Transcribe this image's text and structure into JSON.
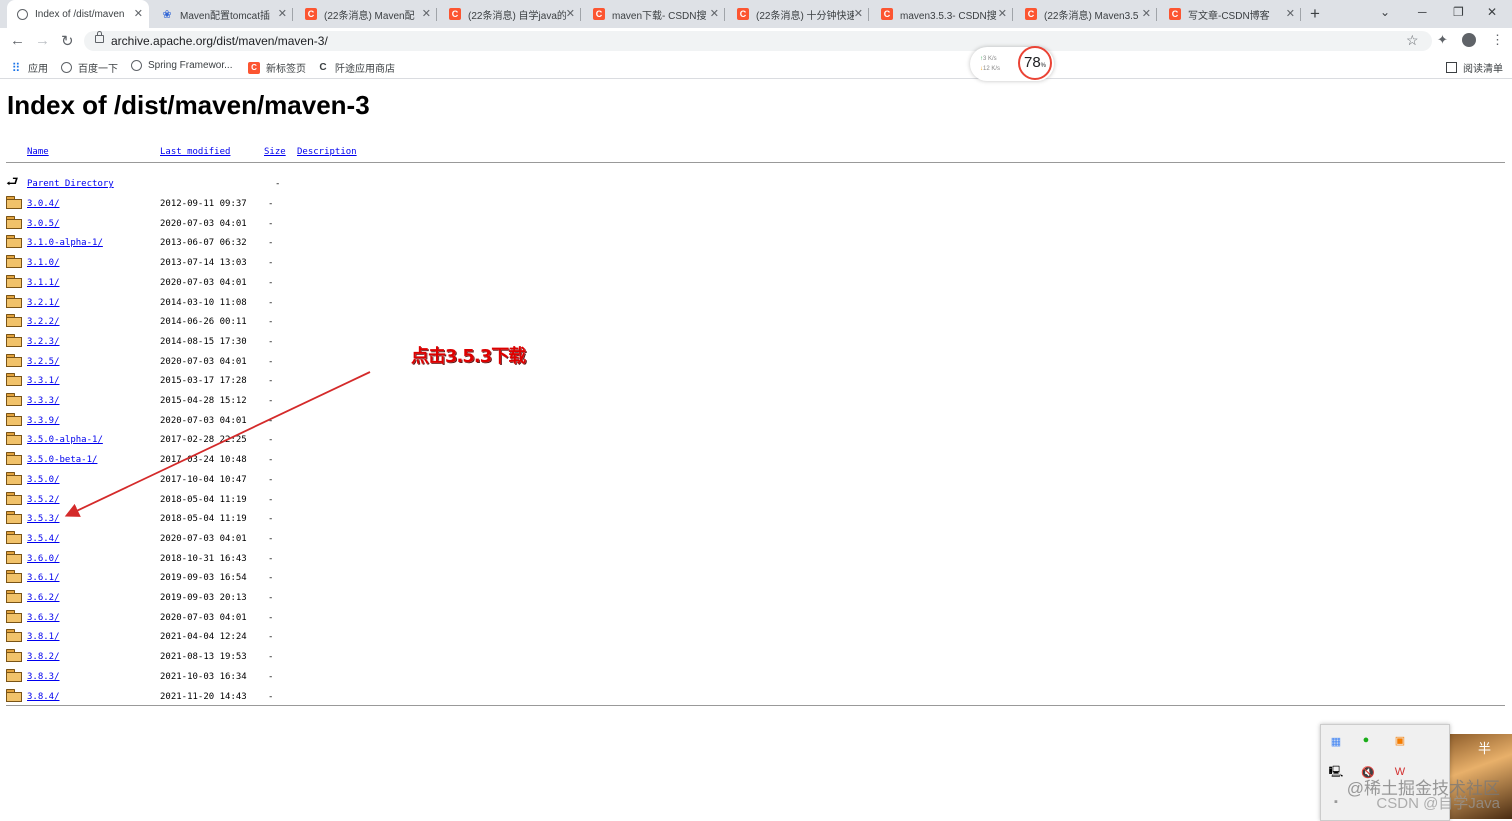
{
  "browser": {
    "tabs": [
      {
        "title": "Index of /dist/maven",
        "icon": "globe-icon",
        "active": true
      },
      {
        "title": "Maven配置tomcat插",
        "icon": "paw-icon"
      },
      {
        "title": "(22条消息) Maven配",
        "icon": "csdn-icon"
      },
      {
        "title": "(22条消息) 自学java的",
        "icon": "csdn-icon"
      },
      {
        "title": "maven下载- CSDN搜",
        "icon": "csdn-icon"
      },
      {
        "title": "(22条消息) 十分钟快速",
        "icon": "csdn-icon"
      },
      {
        "title": "maven3.5.3- CSDN搜",
        "icon": "csdn-icon"
      },
      {
        "title": "(22条消息) Maven3.5",
        "icon": "csdn-icon"
      },
      {
        "title": "写文章-CSDN博客",
        "icon": "csdn-icon"
      }
    ],
    "url": "archive.apache.org/dist/maven/maven-3/",
    "bookmarks": [
      {
        "label": "应用",
        "icon": "apps-grid-icon"
      },
      {
        "label": "百度一下",
        "icon": "globe-icon"
      },
      {
        "label": "Spring Framewor...",
        "icon": "globe-icon"
      },
      {
        "label": "新标签页",
        "icon": "csdn-icon"
      },
      {
        "label": "阡途应用商店",
        "icon": "c-icon"
      }
    ],
    "reading_list": "阅读清单",
    "speed": {
      "up": "3 K/s",
      "down": "12 K/s",
      "percent": "78",
      "unit": "%"
    }
  },
  "page": {
    "title": "Index of /dist/maven/maven-3",
    "columns": {
      "name": "Name",
      "modified": "Last modified",
      "size": "Size",
      "description": "Description"
    },
    "parent": {
      "name": "Parent Directory",
      "size": "-"
    },
    "rows": [
      {
        "name": "3.0.4/",
        "date": "2012-09-11 09:37",
        "size": "-"
      },
      {
        "name": "3.0.5/",
        "date": "2020-07-03 04:01",
        "size": "-"
      },
      {
        "name": "3.1.0-alpha-1/",
        "date": "2013-06-07 06:32",
        "size": "-"
      },
      {
        "name": "3.1.0/",
        "date": "2013-07-14 13:03",
        "size": "-"
      },
      {
        "name": "3.1.1/",
        "date": "2020-07-03 04:01",
        "size": "-"
      },
      {
        "name": "3.2.1/",
        "date": "2014-03-10 11:08",
        "size": "-"
      },
      {
        "name": "3.2.2/",
        "date": "2014-06-26 00:11",
        "size": "-"
      },
      {
        "name": "3.2.3/",
        "date": "2014-08-15 17:30",
        "size": "-"
      },
      {
        "name": "3.2.5/",
        "date": "2020-07-03 04:01",
        "size": "-"
      },
      {
        "name": "3.3.1/",
        "date": "2015-03-17 17:28",
        "size": "-"
      },
      {
        "name": "3.3.3/",
        "date": "2015-04-28 15:12",
        "size": "-"
      },
      {
        "name": "3.3.9/",
        "date": "2020-07-03 04:01",
        "size": "-"
      },
      {
        "name": "3.5.0-alpha-1/",
        "date": "2017-02-28 22:25",
        "size": "-"
      },
      {
        "name": "3.5.0-beta-1/",
        "date": "2017-03-24 10:48",
        "size": "-"
      },
      {
        "name": "3.5.0/",
        "date": "2017-10-04 10:47",
        "size": "-"
      },
      {
        "name": "3.5.2/",
        "date": "2018-05-04 11:19",
        "size": "-"
      },
      {
        "name": "3.5.3/",
        "date": "2018-05-04 11:19",
        "size": "-"
      },
      {
        "name": "3.5.4/",
        "date": "2020-07-03 04:01",
        "size": "-"
      },
      {
        "name": "3.6.0/",
        "date": "2018-10-31 16:43",
        "size": "-"
      },
      {
        "name": "3.6.1/",
        "date": "2019-09-03 16:54",
        "size": "-"
      },
      {
        "name": "3.6.2/",
        "date": "2019-09-03 20:13",
        "size": "-"
      },
      {
        "name": "3.6.3/",
        "date": "2020-07-03 04:01",
        "size": "-"
      },
      {
        "name": "3.8.1/",
        "date": "2021-04-04 12:24",
        "size": "-"
      },
      {
        "name": "3.8.2/",
        "date": "2021-08-13 19:53",
        "size": "-"
      },
      {
        "name": "3.8.3/",
        "date": "2021-10-03 16:34",
        "size": "-"
      },
      {
        "name": "3.8.4/",
        "date": "2021-11-20 14:43",
        "size": "-"
      }
    ]
  },
  "annotation": {
    "text": "点击3.5.3下载",
    "color": "#dd0000"
  },
  "overlay": {
    "wallpaper_text": "半",
    "watermark": "@稀土掘金技术社区",
    "watermark2": "CSDN @自学Java"
  },
  "colors": {
    "link": "#0000ee",
    "csdn": "#fc5531"
  }
}
